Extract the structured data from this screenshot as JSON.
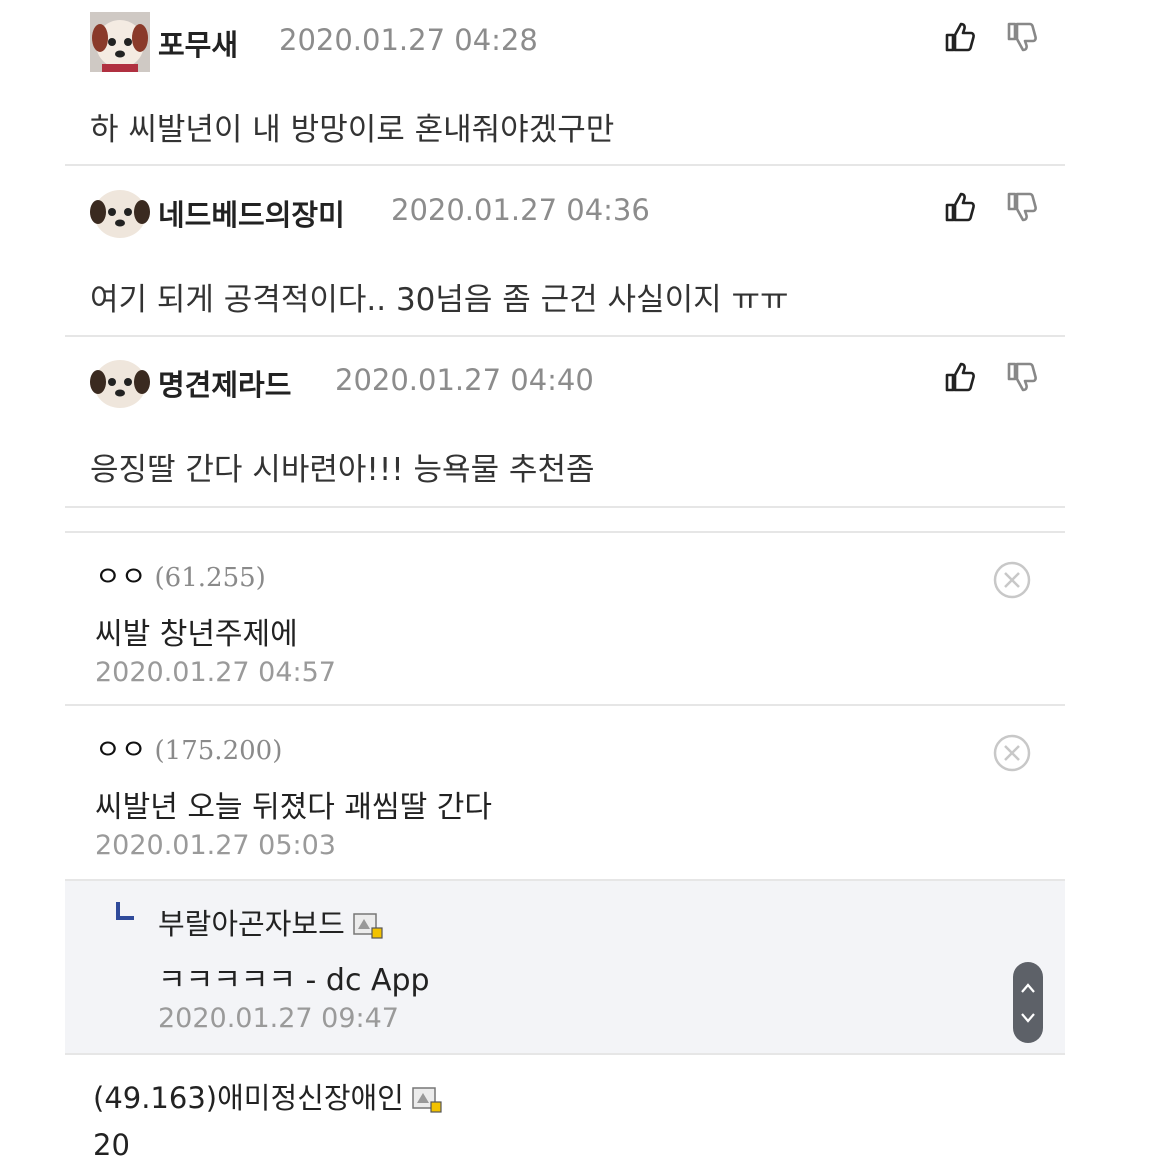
{
  "comments": [
    {
      "nickname": "포무새",
      "date": "2020.01.27 04:28",
      "text": "하 씨발년이 내 방망이로 혼내줘야겠구만"
    },
    {
      "nickname": "네드베드의장미",
      "date": "2020.01.27 04:36",
      "text": "여기 되게 공격적이다.. 30넘음 좀 근건 사실이지 ㅠㅠ"
    },
    {
      "nickname": "명견제라드",
      "date": "2020.01.27 04:40",
      "text": "응징딸 간다 시바련아!!! 능욕물 추천좀"
    }
  ],
  "replies": [
    {
      "name": "ㅇㅇ",
      "ip": "(61.255)",
      "text": "씨발 창년주제에",
      "date": "2020.01.27 04:57"
    },
    {
      "name": "ㅇㅇ",
      "ip": "(175.200)",
      "text": "씨발년 오늘 뒤졌다 괘씸딸 간다",
      "date": "2020.01.27 05:03"
    }
  ],
  "nested_reply": {
    "name": "부랄아곤자보드",
    "text": "ㅋㅋㅋㅋㅋ - dc App",
    "date": "2020.01.27 09:47"
  },
  "last_comment": {
    "header": "(49.163)애미정신장애인",
    "text": "20"
  },
  "colors": {
    "accent": "#2f4a9a",
    "divider": "#e6e6e6",
    "nested_bg": "#f3f4f7"
  }
}
